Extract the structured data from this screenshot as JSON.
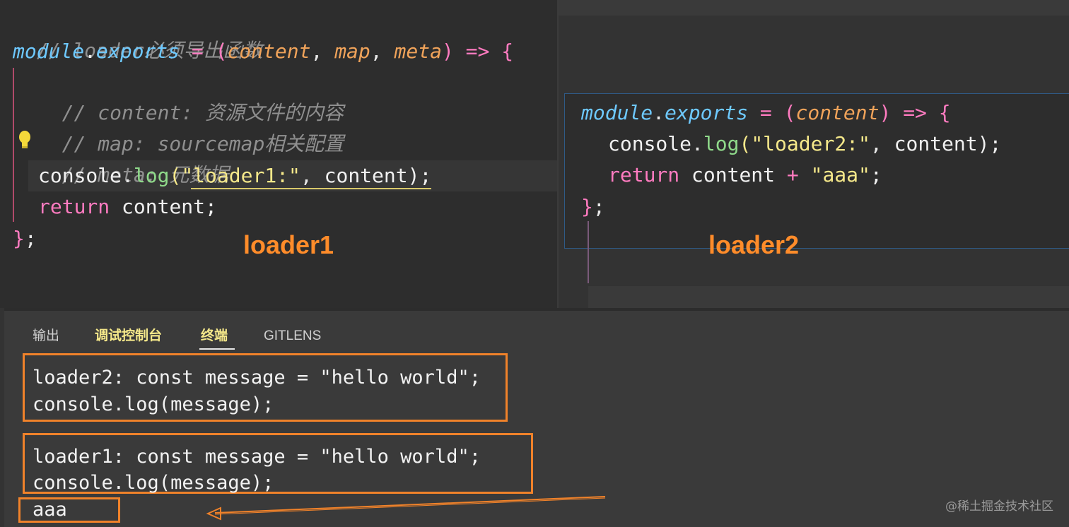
{
  "left_editor": {
    "line1_comment": "// loader必须导出函数",
    "line2": {
      "module": "module",
      "dot": ".",
      "exports": "exports",
      "eq": " = ",
      "paren_open": "(",
      "p1": "content",
      "c1": ", ",
      "p2": "map",
      "c2": ", ",
      "p3": "meta",
      "paren_close": ")",
      "arrow": " => ",
      "brace": "{"
    },
    "line3_comment": "// content: 资源文件的内容",
    "line4_comment": "// map: sourcemap相关配置",
    "line5_comment": "// meta: 元数据",
    "line6": {
      "obj": "console",
      "dot": ".",
      "fn": "log",
      "open": "(",
      "str": "\"loader1:\"",
      "comma": ", ",
      "arg": "content",
      "close": ");"
    },
    "line7": {
      "kw": "return",
      "rest": " content;"
    },
    "line8": {
      "brace": "}",
      "semi": ";"
    },
    "label": "loader1"
  },
  "right_editor": {
    "line1": {
      "module": "module",
      "dot": ".",
      "exports": "exports",
      "eq": " = ",
      "paren_open": "(",
      "p1": "content",
      "paren_close": ")",
      "arrow": " => ",
      "brace": "{"
    },
    "line2": {
      "obj": "console",
      "dot": ".",
      "fn": "log",
      "open": "(",
      "str": "\"loader2:\"",
      "comma": ", ",
      "arg": "content",
      "close": ");"
    },
    "line3": {
      "kw": "return",
      "mid": " content ",
      "plus": "+",
      "sp": " ",
      "str": "\"aaa\"",
      "semi": ";"
    },
    "line4": {
      "brace": "}",
      "semi": ";"
    },
    "label": "loader2"
  },
  "panel": {
    "tabs": [
      "输出",
      "调试控制台",
      "终端",
      "GITLENS"
    ],
    "active_tab": "终端",
    "output": [
      "loader2: const message = \"hello world\";",
      "console.log(message);",
      "loader1: const message = \"hello world\";",
      "console.log(message);",
      "aaa"
    ]
  },
  "watermark": "@稀土掘金技术社区",
  "colors": {
    "annotation": "#f0822a",
    "label": "#ff8c2a"
  }
}
